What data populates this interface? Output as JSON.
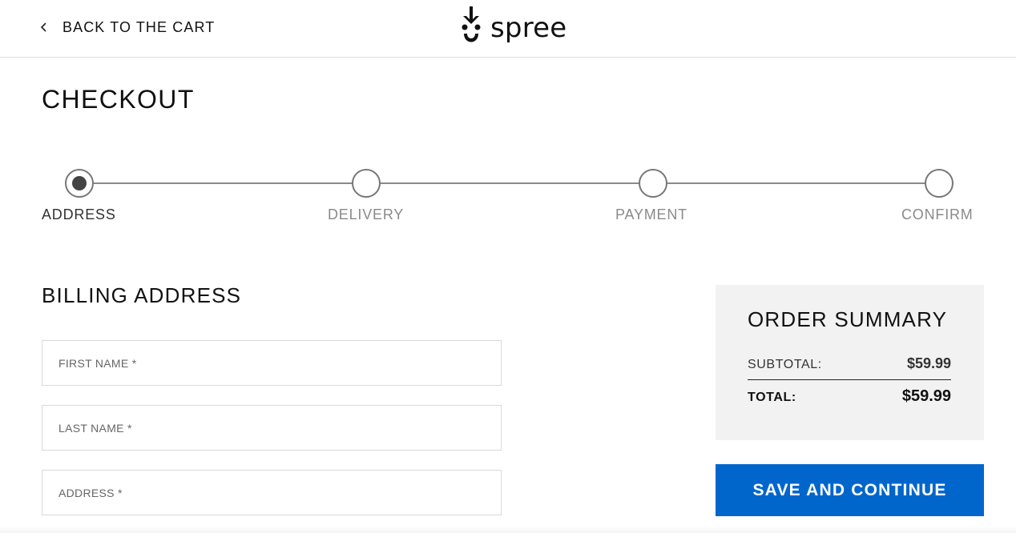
{
  "header": {
    "back_label": "BACK TO THE CART",
    "logo_text": "spree"
  },
  "page_title": "CHECKOUT",
  "steps": [
    {
      "label": "ADDRESS",
      "state": "active"
    },
    {
      "label": "DELIVERY",
      "state": "inactive"
    },
    {
      "label": "PAYMENT",
      "state": "inactive"
    },
    {
      "label": "CONFIRM",
      "state": "inactive"
    }
  ],
  "billing": {
    "title": "BILLING ADDRESS",
    "fields": [
      {
        "placeholder": "FIRST NAME *",
        "value": ""
      },
      {
        "placeholder": "LAST NAME *",
        "value": ""
      },
      {
        "placeholder": "ADDRESS *",
        "value": ""
      }
    ]
  },
  "summary": {
    "title": "ORDER SUMMARY",
    "subtotal_label": "SUBTOTAL:",
    "subtotal_value": "$59.99",
    "total_label": "TOTAL:",
    "total_value": "$59.99"
  },
  "actions": {
    "save_label": "SAVE AND CONTINUE"
  },
  "colors": {
    "primary_button": "#0066cc",
    "summary_bg": "#f2f2f2",
    "active_step": "#444444",
    "inactive_step": "#8a8a8a"
  },
  "icons": {
    "back": "chevron-left-icon",
    "logo": "spree-logo-icon"
  }
}
